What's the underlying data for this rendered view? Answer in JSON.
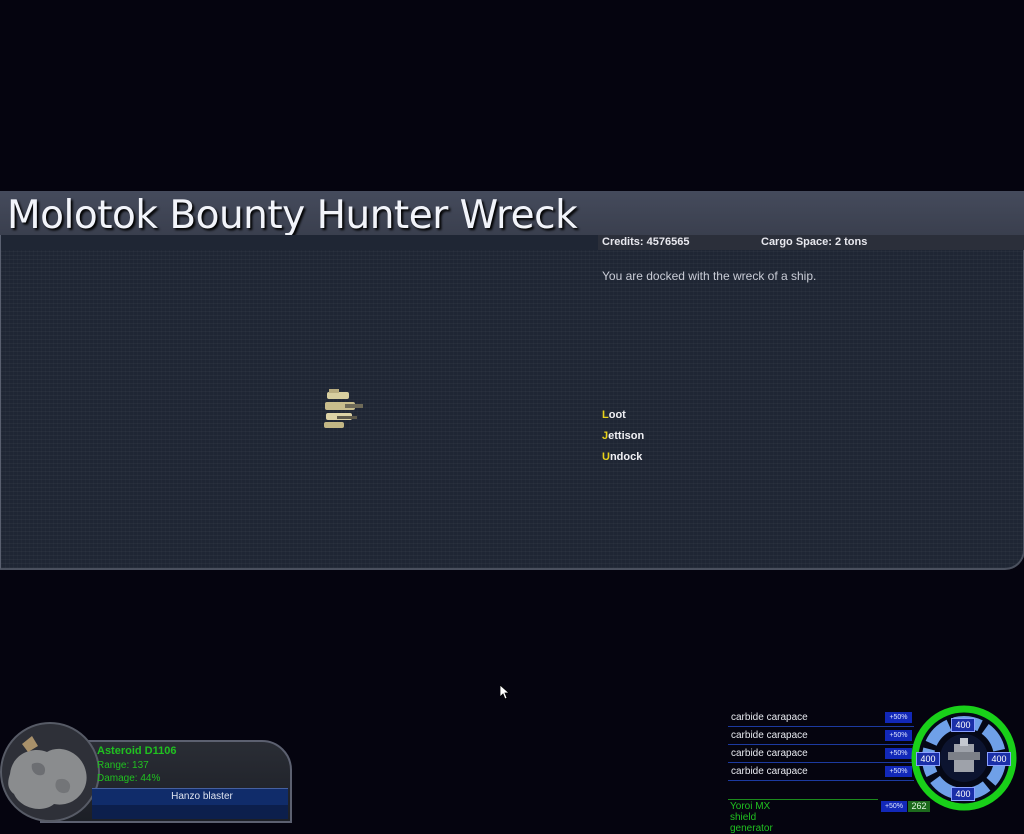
{
  "dialog": {
    "title": "Molotok Bounty Hunter Wreck",
    "credits": "Credits: 4576565",
    "cargo": "Cargo Space:  2 tons",
    "description": "You are docked with the wreck of a ship.",
    "actions": [
      {
        "key": "L",
        "rest": "oot"
      },
      {
        "key": "J",
        "rest": "ettison"
      },
      {
        "key": "U",
        "rest": "ndock"
      }
    ]
  },
  "target": {
    "name": "Asteroid D1106",
    "range": "Range: 137",
    "damage": "Damage: 44%",
    "weapon": "Hanzo blaster"
  },
  "armor": {
    "segments": [
      {
        "name": "carbide carapace",
        "bonus": "+50%"
      },
      {
        "name": "carbide carapace",
        "bonus": "+50%"
      },
      {
        "name": "carbide carapace",
        "bonus": "+50%"
      },
      {
        "name": "carbide carapace",
        "bonus": "+50%"
      }
    ],
    "shield_name": "Yoroi MX shield generator",
    "shield_bonus": "+50%",
    "shield_value": "262"
  },
  "gauge": {
    "top": "400",
    "left": "400",
    "right": "400",
    "bottom": "400",
    "ring_color": "#19d019",
    "segment_color": "#6fa0e8"
  }
}
